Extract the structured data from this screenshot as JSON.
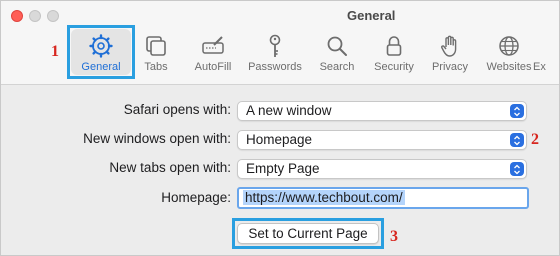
{
  "window": {
    "title": "General"
  },
  "tabs": [
    {
      "label": "General",
      "icon": "gear-icon"
    },
    {
      "label": "Tabs",
      "icon": "tabs-icon"
    },
    {
      "label": "AutoFill",
      "icon": "autofill-icon"
    },
    {
      "label": "Passwords",
      "icon": "key-icon"
    },
    {
      "label": "Search",
      "icon": "search-icon"
    },
    {
      "label": "Security",
      "icon": "lock-icon"
    },
    {
      "label": "Privacy",
      "icon": "hand-icon"
    },
    {
      "label": "Websites",
      "icon": "globe-icon"
    },
    {
      "label": "Ex",
      "icon": "extensions-icon"
    }
  ],
  "settings": {
    "safari_opens_label": "Safari opens with:",
    "safari_opens_value": "A new window",
    "new_windows_label": "New windows open with:",
    "new_windows_value": "Homepage",
    "new_tabs_label": "New tabs open with:",
    "new_tabs_value": "Empty Page",
    "homepage_label": "Homepage:",
    "homepage_value": "https://www.techbout.com/",
    "set_current_button": "Set to Current Page"
  },
  "annotations": {
    "one": "1",
    "two": "2",
    "three": "3"
  },
  "colors": {
    "accent": "#2a6fe0",
    "callout": "#2a9fe0",
    "annotation_number": "#d7261f"
  }
}
